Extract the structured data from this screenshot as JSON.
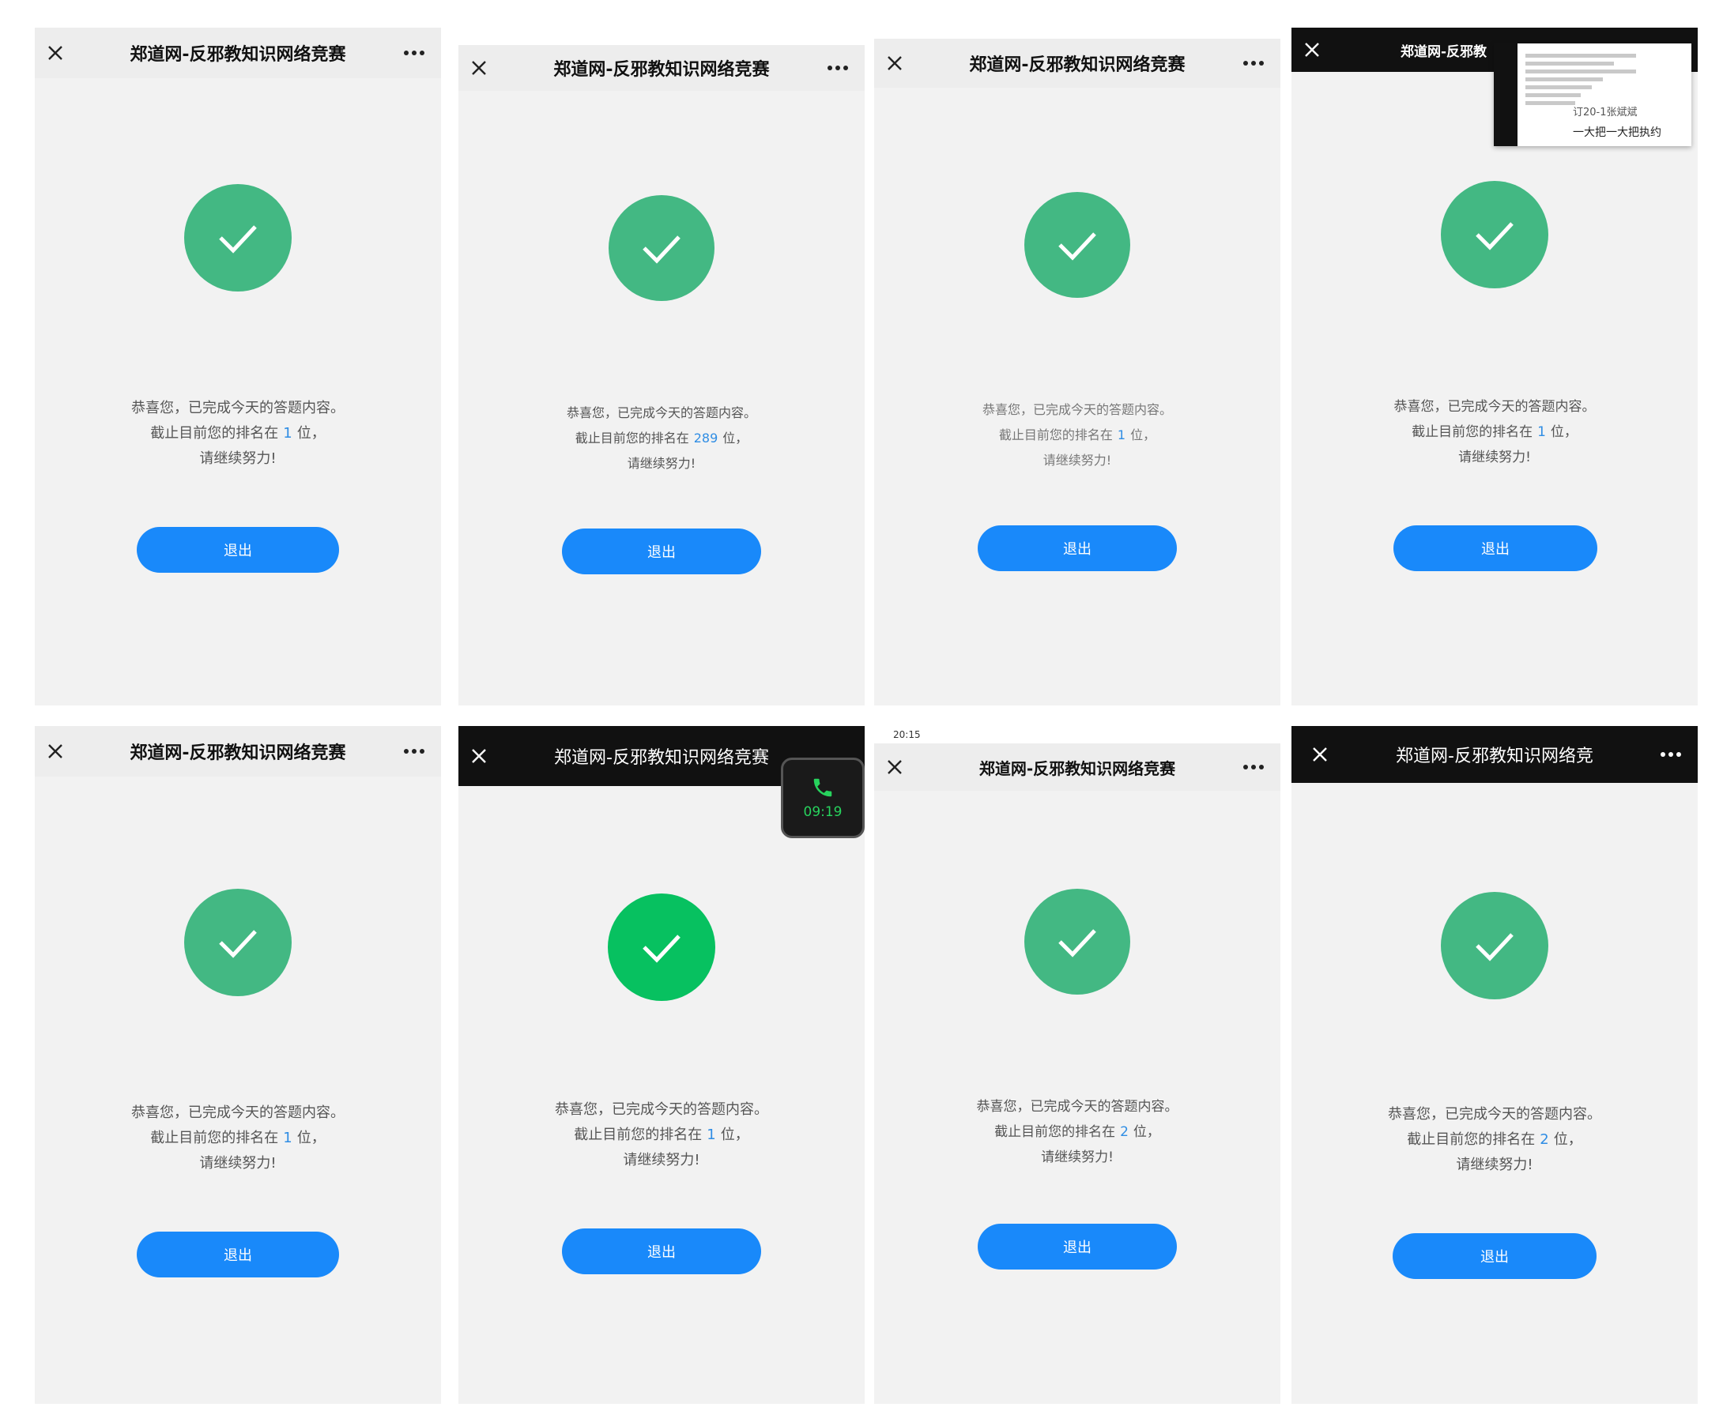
{
  "app": {
    "title": "郑道网-反邪教知识网络竞赛"
  },
  "cards": [
    {
      "title": "郑道网-反邪教知识网络竞赛",
      "line1": "恭喜您，已完成今天的答题内容。",
      "line2_pre": "截止目前您的排名在",
      "rank": "1",
      "line2_post": "位，",
      "line3": "请继续努力!",
      "exit": "退出"
    },
    {
      "title": "郑道网-反邪教知识网络竞赛",
      "line1": "恭喜您，已完成今天的答题内容。",
      "line2_pre": "截止目前您的排名在",
      "rank": "289",
      "line2_post": "位，",
      "line3": "请继续努力!",
      "exit": "退出"
    },
    {
      "title": "郑道网-反邪教知识网络竞赛",
      "line1": "恭喜您，已完成今天的答题内容。",
      "line2_pre": "截止目前您的排名在",
      "rank": "1",
      "line2_post": "位，",
      "line3": "请继续努力!",
      "exit": "退出"
    },
    {
      "title": "郑道网-反邪教",
      "line1": "恭喜您，已完成今天的答题内容。",
      "line2_pre": "截止目前您的排名在",
      "rank": "1",
      "line2_post": "位，",
      "line3": "请继续努力!",
      "exit": "退出",
      "note": {
        "line1": "订20-1张斌斌",
        "line2": "一大把一大把执约"
      }
    },
    {
      "title": "郑道网-反邪教知识网络竞赛",
      "line1": "恭喜您，已完成今天的答题内容。",
      "line2_pre": "截止目前您的排名在",
      "rank": "1",
      "line2_post": "位，",
      "line3": "请继续努力!",
      "exit": "退出"
    },
    {
      "title": "郑道网-反邪教知识网络竞赛",
      "line1": "恭喜您，已完成今天的答题内容。",
      "line2_pre": "截止目前您的排名在",
      "rank": "1",
      "line2_post": "位，",
      "line3": "请继续努力!",
      "exit": "退出",
      "call": {
        "time": "09:19"
      }
    },
    {
      "title": "郑道网-反邪教知识网络竞赛",
      "line1": "恭喜您，已完成今天的答题内容。",
      "line2_pre": "截止目前您的排名在",
      "rank": "2",
      "line2_post": "位，",
      "line3": "请继续努力!",
      "exit": "退出",
      "status_time": "20:15"
    },
    {
      "title": "郑道网-反邪教知识网络竞",
      "line1": "恭喜您，已完成今天的答题内容。",
      "line2_pre": "截止目前您的排名在",
      "rank": "2",
      "line2_post": "位，",
      "line3": "请继续努力!",
      "exit": "退出"
    }
  ],
  "colors": {
    "check": "#43b883",
    "check_bright": "#07c160",
    "button": "#1989fa",
    "rank": "#2f8de4"
  },
  "icons": {
    "close": "close-icon",
    "more": "more-icon",
    "check": "check-icon",
    "phone": "phone-icon"
  }
}
